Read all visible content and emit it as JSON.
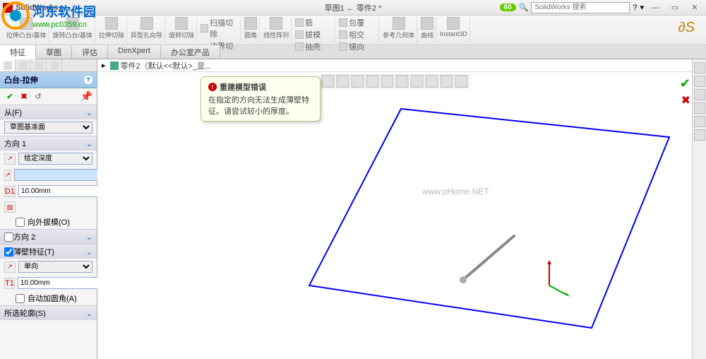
{
  "titlebar": {
    "app": "SolidWorks",
    "doc": "草图1 ← 零件2 *",
    "search_ph": "SolidWorks 搜索",
    "speed": "60"
  },
  "ribbon": [
    {
      "label": "拉伸凸台/基体"
    },
    {
      "label": "旋转凸台/基体"
    },
    {
      "label": "拉伸切除"
    },
    {
      "label": "异型孔向导"
    },
    {
      "label": "旋转切除"
    },
    {
      "label": "扫描切除"
    },
    {
      "label": "边界切除"
    },
    {
      "label": "圆角"
    },
    {
      "label": "线性阵列"
    },
    {
      "label": "筋"
    },
    {
      "label": "拔模"
    },
    {
      "label": "抽壳"
    },
    {
      "label": "包覆"
    },
    {
      "label": "相交"
    },
    {
      "label": "镜向"
    },
    {
      "label": "参考几何体"
    },
    {
      "label": "曲线"
    },
    {
      "label": "Instant3D"
    }
  ],
  "tabs": [
    "特征",
    "草图",
    "评估",
    "DimXpert",
    "办公室产品"
  ],
  "active_tab": 0,
  "feature_title": "凸台-拉伸",
  "breadcrumb": "零件2（默认<<默认>_显...",
  "sections": {
    "from": {
      "title": "从(F)",
      "select": "草图基准面"
    },
    "dir1": {
      "title": "方向 1",
      "select": "给定深度",
      "value": "",
      "depth_label": "D1",
      "depth": "10.00mm",
      "draft_chk": "向外拔模(O)"
    },
    "dir2": {
      "title": "方向 2"
    },
    "thin": {
      "title": "薄壁特征(T)",
      "select": "单向",
      "t_label": "T1",
      "thickness": "10.00mm",
      "chk": "自动加圆角(A)"
    },
    "contour": {
      "title": "所选轮廓(S)"
    }
  },
  "tooltip": {
    "title": "重建模型错误",
    "body": "在指定的方向无法生成薄壁特征。请尝试较小的厚度。"
  },
  "watermark": "www.pHome.NET",
  "logo_overlay": {
    "name": "河东软件园",
    "url": "www.pc0359.cn"
  }
}
